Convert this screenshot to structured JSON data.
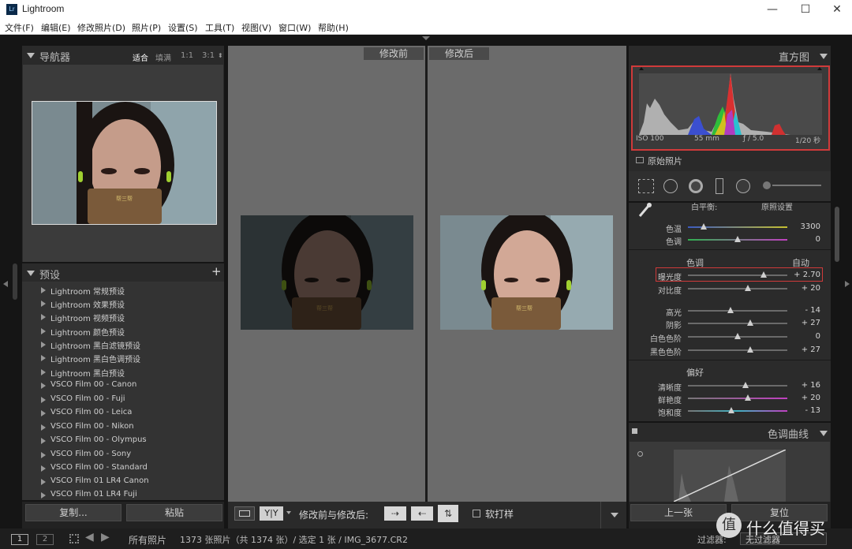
{
  "titlebar": {
    "logo": "Lr",
    "title": "Lightroom",
    "minimize": "—",
    "maximize": "☐",
    "close": "✕"
  },
  "menu": [
    "文件(F)",
    "编辑(E)",
    "修改照片(D)",
    "照片(P)",
    "设置(S)",
    "工具(T)",
    "视图(V)",
    "窗口(W)",
    "帮助(H)"
  ],
  "navigator": {
    "title": "导航器",
    "zoom_options": [
      "适合",
      "填满",
      "1:1",
      "3:1"
    ]
  },
  "presets": {
    "title": "预设",
    "add": "+",
    "items": [
      "Lightroom 常规预设",
      "Lightroom 效果预设",
      "Lightroom 视频预设",
      "Lightroom 颜色预设",
      "Lightroom 黑白滤镜预设",
      "Lightroom 黑白色调预设",
      "Lightroom 黑白预设",
      "VSCO Film 00 - Canon",
      "VSCO Film 00 - Fuji",
      "VSCO Film 00 - Leica",
      "VSCO Film 00 - Nikon",
      "VSCO Film 00 - Olympus",
      "VSCO Film 00 - Sony",
      "VSCO Film 00 - Standard",
      "VSCO Film 01 LR4 Canon",
      "VSCO Film 01 LR4 Fuji"
    ]
  },
  "left_buttons": {
    "copy": "复制...",
    "paste": "粘贴"
  },
  "compare": {
    "before_label": "修改前",
    "after_label": "修改后",
    "before_brightness": 0.45,
    "after_brightness": 1.0
  },
  "toolbar": {
    "view_mode": "Y|Y",
    "compare_label": "修改前与修改后:",
    "soft_proof": "软打样"
  },
  "histogram": {
    "title": "直方图",
    "iso": "ISO 100",
    "focal": "55 mm",
    "aperture": "ƒ / 5.0",
    "shutter": "1/20 秒",
    "original_photo": "原始照片"
  },
  "basic": {
    "wb_label": "白平衡:",
    "wb_value": "原照设置",
    "temp": {
      "label": "色温",
      "value": "3300",
      "pos": 0.16
    },
    "tint": {
      "label": "色调",
      "value": "0",
      "pos": 0.5
    },
    "tone_title": "色调",
    "auto": "自动",
    "exposure": {
      "label": "曝光度",
      "value": "+ 2.70",
      "pos": 0.76
    },
    "contrast": {
      "label": "对比度",
      "value": "+ 20",
      "pos": 0.6
    },
    "highlights": {
      "label": "高光",
      "value": "- 14",
      "pos": 0.43
    },
    "shadows": {
      "label": "阴影",
      "value": "+ 27",
      "pos": 0.63
    },
    "whites": {
      "label": "白色色阶",
      "value": "0",
      "pos": 0.5
    },
    "blacks": {
      "label": "黑色色阶",
      "value": "+ 27",
      "pos": 0.63
    },
    "presence_title": "偏好",
    "clarity": {
      "label": "清晰度",
      "value": "+ 16",
      "pos": 0.58
    },
    "vibrance": {
      "label": "鲜艳度",
      "value": "+ 20",
      "pos": 0.6
    },
    "saturation": {
      "label": "饱和度",
      "value": "- 13",
      "pos": 0.44
    }
  },
  "tone_curve": {
    "title": "色调曲线"
  },
  "right_buttons": {
    "prev": "上一张",
    "reset": "复位"
  },
  "bottombar": {
    "view1": "1",
    "view2": "2",
    "source": "所有照片",
    "count": "1373 张照片（共 1374 张）/ 选定 1 张 / IMG_3677.CR2",
    "filter_label": "过滤器:",
    "filter_value": "无过滤器"
  },
  "watermark": {
    "badge": "值",
    "text": "什么值得买"
  },
  "colors": {
    "highlight_box": "#d03a3a",
    "panel_bg": "#2a2a2a",
    "view_bg": "#6b6b6b"
  }
}
